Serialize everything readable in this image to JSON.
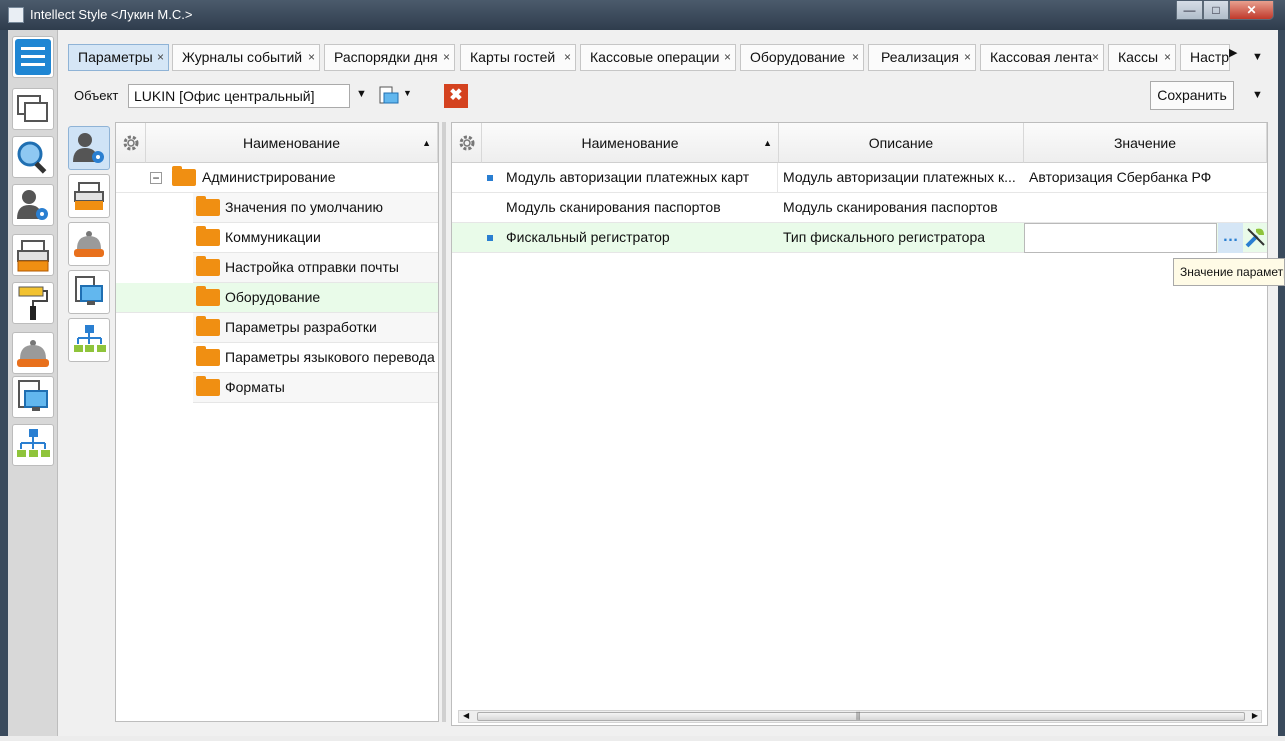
{
  "window": {
    "title": "Intellect Style  <Лукин М.С.>",
    "minimize": "—",
    "maximize": "□",
    "close": "✕"
  },
  "tabs": [
    {
      "label": "Параметры",
      "active": true
    },
    {
      "label": "Журналы событий"
    },
    {
      "label": "Распорядки дня"
    },
    {
      "label": "Карты гостей"
    },
    {
      "label": "Кассовые операции"
    },
    {
      "label": "Оборудование"
    },
    {
      "label": "Реализация"
    },
    {
      "label": "Кассовая лента"
    },
    {
      "label": "Кассы"
    },
    {
      "label": "Настр"
    }
  ],
  "tab_close_glyph": "×",
  "toolbar": {
    "object_label": "Объект",
    "object_value": "LUKIN [Офис центральный]",
    "dropdown_glyph": "▼",
    "clear_glyph": "✖",
    "save_label": "Сохранить"
  },
  "left_grid": {
    "header": "Наименование",
    "sort_glyph": "▲",
    "expander_glyph": "−",
    "root": "Администрирование",
    "items": [
      "Значения по умолчанию",
      "Коммуникации",
      "Настройка отправки почты",
      "Оборудование",
      "Параметры разработки",
      "Параметры языкового перевода",
      "Форматы"
    ],
    "selected": "Оборудование"
  },
  "right_grid": {
    "headers": {
      "name": "Наименование",
      "description": "Описание",
      "value": "Значение"
    },
    "rows": [
      {
        "name": "Модуль авторизации платежных карт",
        "description": "Модуль авторизации платежных к...",
        "value": "Авторизация Сбербанка РФ",
        "marker": true
      },
      {
        "name": "Модуль сканирования паспортов",
        "description": "Модуль сканирования паспортов",
        "value": "",
        "marker": false
      },
      {
        "name": "Фискальный регистратор",
        "description": "Тип фискального регистратора",
        "value": "",
        "marker": true,
        "selected": true
      }
    ],
    "ellipsis": "…"
  },
  "tooltip": "Значение параметра",
  "scroll_grip": "⫼",
  "colors": {
    "accent": "#d5e6f6",
    "selected_row": "#e9fbe9",
    "folder": "#f08f12",
    "clear": "#d4421f",
    "marker": "#2a7fd1"
  },
  "icons": [
    "menu-icon",
    "windows-icon",
    "search-icon",
    "user-settings-icon",
    "cash-register-icon",
    "paint-roller-icon",
    "service-bell-icon",
    "monitor-icon",
    "hierarchy-icon",
    "gear-icon",
    "wrench-icon",
    "folder-icon"
  ]
}
